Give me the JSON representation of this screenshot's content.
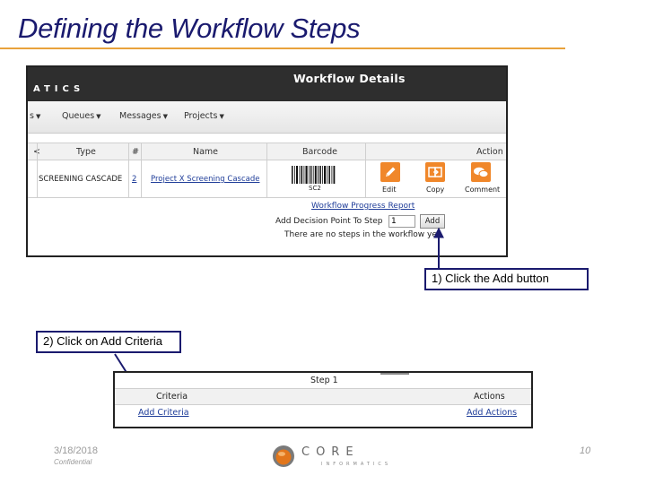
{
  "slide": {
    "title": "Defining the Workflow Steps",
    "accent_color": "#e9a23b",
    "title_color": "#1a1a6e"
  },
  "screenshot1": {
    "brand": "ATICS",
    "window_title": "Workflow Details",
    "nav": [
      "s",
      "Queues",
      "Messages",
      "Projects"
    ],
    "table": {
      "headers": [
        "<",
        "Type",
        "#",
        "Name",
        "Barcode",
        "Action"
      ],
      "row": {
        "type": "SCREENING CASCADE",
        "number": "2",
        "name": "Project X Screening Cascade",
        "barcode_text": "SC2"
      },
      "actions": [
        "Edit",
        "Copy",
        "Comment"
      ]
    },
    "workflow_progress_link": "Workflow Progress Report",
    "add_decision_label": "Add Decision Point To Step",
    "step_value": "1",
    "add_button": "Add",
    "no_steps_message": "There are no steps in the workflow yet."
  },
  "callouts": {
    "one": "1) Click the Add button",
    "two": "2) Click on Add Criteria"
  },
  "screenshot2": {
    "step_title": "Step 1",
    "headers": [
      "Criteria",
      "Actions"
    ],
    "add_criteria": "Add Criteria",
    "add_actions": "Add Actions"
  },
  "footer": {
    "date": "3/18/2018",
    "confidential": "Confidential",
    "page_number": "10",
    "logo_word": "CORE",
    "logo_sub": "INFORMATICS"
  }
}
